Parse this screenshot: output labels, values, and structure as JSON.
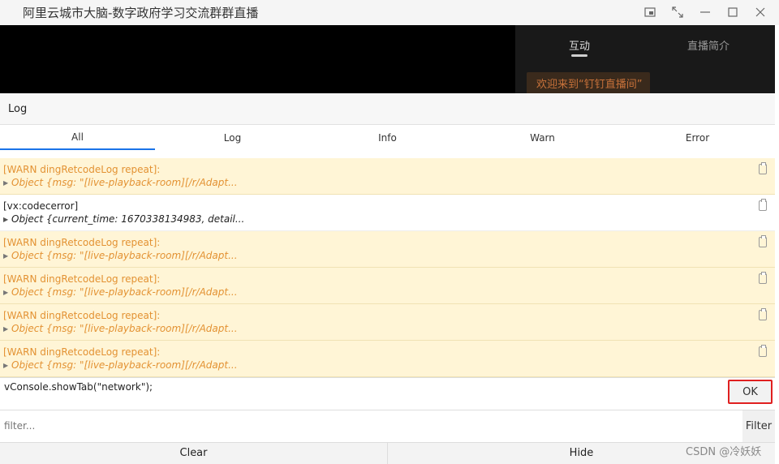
{
  "window": {
    "title": "阿里云城市大脑-数字政府学习交流群群直播",
    "buttons": [
      "picture-in-picture-icon",
      "expand-icon",
      "minimize-icon",
      "maximize-icon",
      "close-icon"
    ]
  },
  "live_panel": {
    "tabs": [
      "互动",
      "直播简介"
    ],
    "active_tab": "互动",
    "welcome_text": "欢迎来到“钉钉直播间”"
  },
  "vconsole": {
    "header_label": "Log",
    "tabs": [
      "All",
      "Log",
      "Info",
      "Warn",
      "Error"
    ],
    "active_tab": "All",
    "logs": [
      {
        "level": "warn",
        "line1": "[WARN dingRetcodeLog repeat]:",
        "line2": "Object {msg: \"[live-playback-room][/r/Adapt..."
      },
      {
        "level": "info",
        "line1": "[vx:codecerror]",
        "line2": "Object {current_time: 1670338134983, detail..."
      },
      {
        "level": "warn",
        "line1": "[WARN dingRetcodeLog repeat]:",
        "line2": "Object {msg: \"[live-playback-room][/r/Adapt..."
      },
      {
        "level": "warn",
        "line1": "[WARN dingRetcodeLog repeat]:",
        "line2": "Object {msg: \"[live-playback-room][/r/Adapt..."
      },
      {
        "level": "warn",
        "line1": "[WARN dingRetcodeLog repeat]:",
        "line2": "Object {msg: \"[live-playback-room][/r/Adapt..."
      },
      {
        "level": "warn",
        "line1": "[WARN dingRetcodeLog repeat]:",
        "line2": "Object {msg: \"[live-playback-room][/r/Adapt..."
      }
    ],
    "command_value": "vConsole.showTab(\"network\");",
    "ok_label": "OK",
    "filter_placeholder": "filter...",
    "filter_label": "Filter",
    "clear_label": "Clear",
    "hide_label": "Hide"
  },
  "watermark": "CSDN @冷妖妖",
  "colors": {
    "warn_bg": "#fff5d6",
    "warn_text": "#e39233",
    "highlight_border": "#e02020",
    "tab_active": "#1a73e8"
  }
}
